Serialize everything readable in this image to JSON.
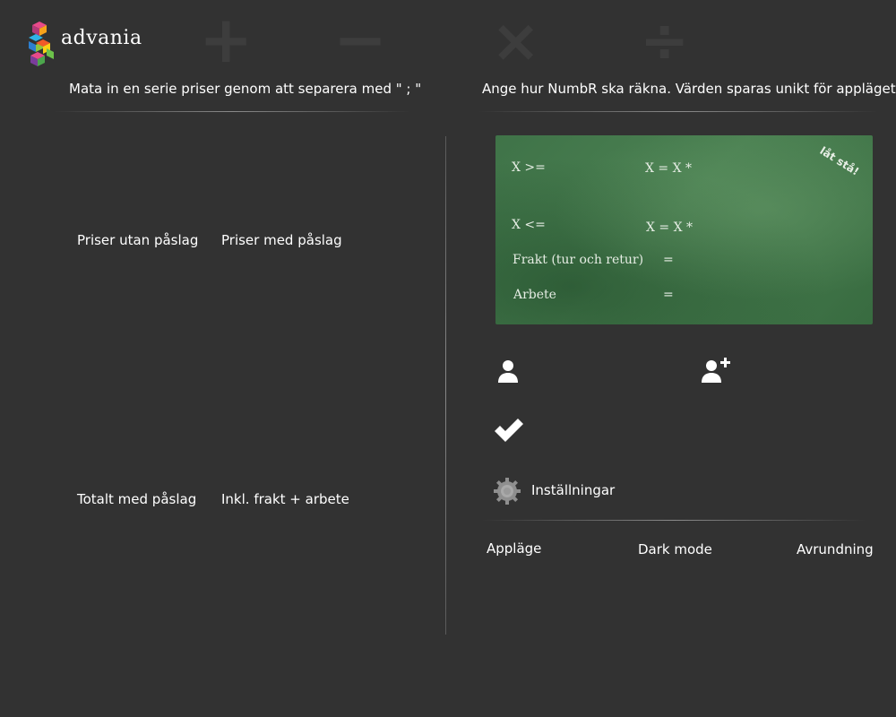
{
  "header": {
    "logo_text": "advania",
    "operators": [
      "+",
      "−",
      "×",
      "÷"
    ]
  },
  "left": {
    "instruction": "Mata in en serie priser genom att separera med \" ; \"",
    "labels": {
      "prices_without_markup": "Priser utan påslag",
      "prices_with_markup": "Priser med påslag",
      "total_with_markup": "Totalt med påslag",
      "incl_freight_work": "Inkl. frakt + arbete"
    }
  },
  "right": {
    "instruction": "Ange hur NumbR ska räkna. Värden sparas unikt för appläget.",
    "board": {
      "row1_condition": "X >=",
      "row1_formula": "X = X *",
      "row2_condition": "X <=",
      "row2_formula": "X = X *",
      "freight_label": "Frakt (tur och retur)",
      "freight_eq": "=",
      "work_label": "Arbete",
      "work_eq": "=",
      "note": "låt stå!"
    },
    "icons": {
      "user": "user-icon",
      "add_user": "add-user-icon",
      "check": "check-icon",
      "settings": "gear-icon"
    },
    "settings_label": "Inställningar",
    "tabs": [
      "Appläge",
      "Dark mode",
      "Avrundning"
    ]
  },
  "colors": {
    "background": "#323232",
    "board_green": "#457a4c",
    "text": "#ffffff",
    "operator": "#3d3d3d"
  }
}
